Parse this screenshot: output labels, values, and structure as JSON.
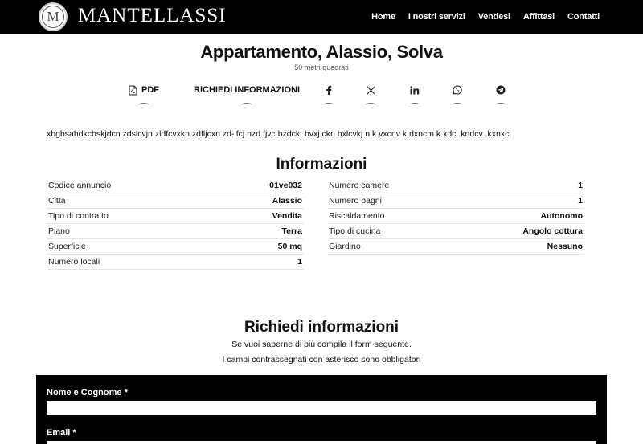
{
  "header": {
    "logo_letter": "M",
    "brand": "MANTELLASSI",
    "nav": [
      "Home",
      "I nostri servizi",
      "Vendesi",
      "Affittasi",
      "Contatti"
    ]
  },
  "listing": {
    "title": "Appartamento, Alassio, Solva",
    "subtitle": "50 metri quadrati",
    "description": "xbgbsahdkcbskjdcn zdslcvjn zldfcvxkn zdfljcxn zd-lfcj nzd.fjvc bzdck. bvxj.ckn bxlcvkj.n k.vxcnv k.dxncm k.xdc .kndcv .kxnxc"
  },
  "actions": {
    "pdf_label": "PDF",
    "request_label": "RICHIEDI INFORMAZIONI",
    "icons": [
      "pdf-icon",
      "facebook-icon",
      "x-icon",
      "linkedin-icon",
      "whatsapp-icon",
      "telegram-icon"
    ]
  },
  "info": {
    "title": "Informazioni",
    "left": [
      {
        "key": "Codice annuncio",
        "value": "01ve032"
      },
      {
        "key": "Citta",
        "value": "Alassio"
      },
      {
        "key": "Tipo di contratto",
        "value": "Vendita"
      },
      {
        "key": "Piano",
        "value": "Terra"
      },
      {
        "key": "Superficie",
        "value": "50 mq"
      },
      {
        "key": "Numero locali",
        "value": "1"
      }
    ],
    "right": [
      {
        "key": "Numero camere",
        "value": "1"
      },
      {
        "key": "Numero bagni",
        "value": "1"
      },
      {
        "key": "Riscaldamento",
        "value": "Autonomo"
      },
      {
        "key": "Tipo di cucina",
        "value": "Angolo cottura"
      },
      {
        "key": "Giardino",
        "value": "Nessuno"
      }
    ]
  },
  "request": {
    "title": "Richiedi informazioni",
    "line1": "Se vuoi saperne di più compila il form seguente.",
    "line2": "I campi contrassegnati con asterisco sono obbligatori",
    "name_label": "Nome e Cognome *",
    "email_label": "Email *"
  }
}
